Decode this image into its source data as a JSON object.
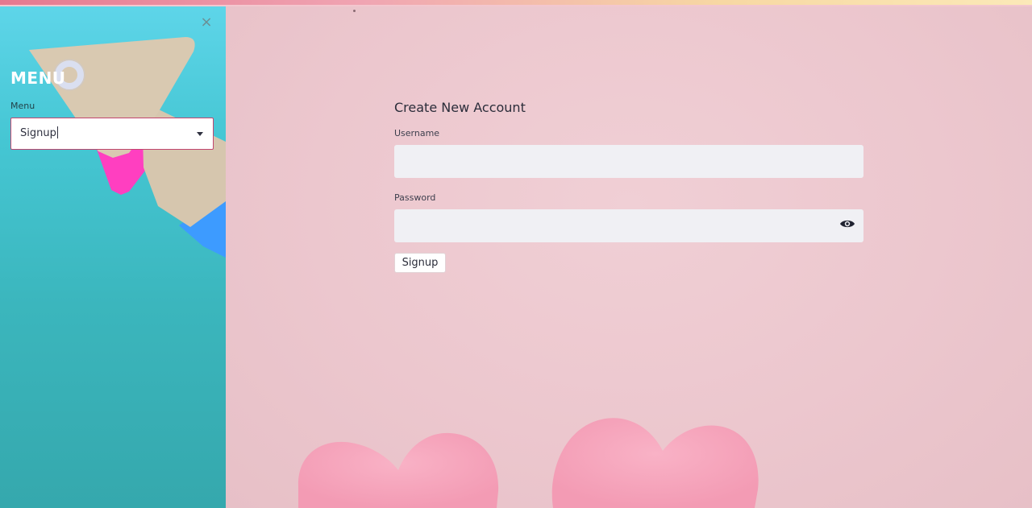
{
  "sidebar": {
    "close_symbol": "×",
    "title": "MENU",
    "select_label": "Menu",
    "select_value": "Signup"
  },
  "form": {
    "title": "Create New Account",
    "username_label": "Username",
    "username_value": "",
    "password_label": "Password",
    "password_value": "",
    "submit_label": "Signup"
  },
  "icons": {
    "close": "close-icon",
    "dropdown": "chevron-down-icon",
    "password_visibility": "eye-icon"
  },
  "colors": {
    "sidebar_background": "#45c6d3",
    "main_background": "#ecc7ce",
    "select_border_focus": "#c2456f",
    "input_background": "#f0f0f4",
    "heading_text": "#2b2d3a",
    "sidebar_title": "#ffffff"
  }
}
